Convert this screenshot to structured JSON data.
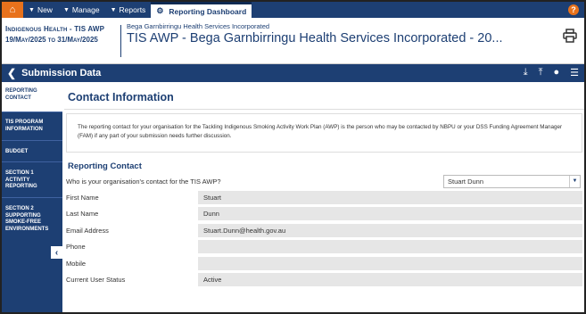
{
  "topbar": {
    "menu": [
      {
        "label": "New"
      },
      {
        "label": "Manage"
      },
      {
        "label": "Reports"
      }
    ],
    "active_tab": "Reporting Dashboard",
    "help": "?"
  },
  "header": {
    "program": "Indigenous Health - TIS AWP",
    "period": "19/May/2025 to 31/May/2025",
    "organisation": "Bega Garnbirringu Health Services Incorporated",
    "title": "TIS AWP - Bega Garnbirringu Health Services Incorporated - 20..."
  },
  "subbar": {
    "title": "Submission Data"
  },
  "sidebar": {
    "items": [
      {
        "label": "REPORTING CONTACT"
      },
      {
        "label": "TIS PROGRAM INFORMATION"
      },
      {
        "label": "BUDGET"
      },
      {
        "label": "SECTION 1 ACTIVITY REPORTING"
      },
      {
        "label": "SECTION 2 SUPPORTING SMOKE-FREE ENVIRONMENTS"
      }
    ]
  },
  "main": {
    "section_title": "Contact Information",
    "info_text": "The reporting contact for your organisation for the Tackling Indigenous Smoking Activity Work Plan (AWP) is the person who may be contacted by NBPU or your DSS Funding Agreement Manager (FAM) if any part of your submission needs further discussion.",
    "reporting_heading": "Reporting Contact",
    "question": "Who is your organisation's contact for the TIS AWP?",
    "selected_contact": "Stuart Dunn",
    "fields": [
      {
        "label": "First Name",
        "value": "Stuart"
      },
      {
        "label": "Last Name",
        "value": "Dunn"
      },
      {
        "label": "Email Address",
        "value": "Stuart.Dunn@health.gov.au"
      },
      {
        "label": "Phone",
        "value": ""
      },
      {
        "label": "Mobile",
        "value": ""
      },
      {
        "label": "Current User Status",
        "value": "Active"
      }
    ]
  },
  "colors": {
    "brand_navy": "#1d3f73",
    "accent_orange": "#e8721c"
  }
}
